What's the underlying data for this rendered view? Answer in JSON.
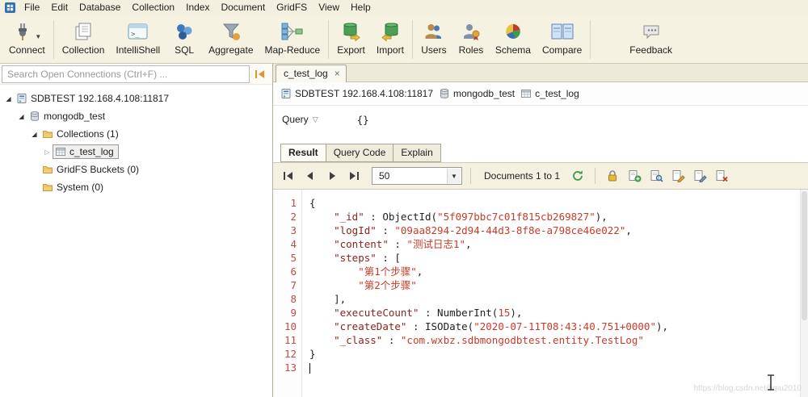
{
  "window": {
    "menu_items": [
      "File",
      "Edit",
      "Database",
      "Collection",
      "Index",
      "Document",
      "GridFS",
      "View",
      "Help"
    ]
  },
  "toolbar": {
    "buttons": [
      {
        "label": "Connect",
        "icon": "connect-icon",
        "dropdown": true,
        "group_end": true
      },
      {
        "label": "Collection",
        "icon": "collection-icon"
      },
      {
        "label": "IntelliShell",
        "icon": "intellishell-icon"
      },
      {
        "label": "SQL",
        "icon": "sql-icon"
      },
      {
        "label": "Aggregate",
        "icon": "aggregate-icon"
      },
      {
        "label": "Map-Reduce",
        "icon": "map-reduce-icon",
        "group_end": true
      },
      {
        "label": "Export",
        "icon": "export-icon"
      },
      {
        "label": "Import",
        "icon": "import-icon",
        "group_end": true
      },
      {
        "label": "Users",
        "icon": "users-icon"
      },
      {
        "label": "Roles",
        "icon": "roles-icon"
      },
      {
        "label": "Schema",
        "icon": "schema-icon"
      },
      {
        "label": "Compare",
        "icon": "compare-icon",
        "group_end": true
      },
      {
        "label": "Feedback",
        "icon": "feedback-icon",
        "far": true
      }
    ]
  },
  "sidebar": {
    "search_placeholder": "Search Open Connections (Ctrl+F) ...",
    "tree": [
      {
        "label": "SDBTEST 192.168.4.108:11817",
        "level": 0,
        "icon": "server-icon",
        "expander": "expanded"
      },
      {
        "label": "mongodb_test",
        "level": 1,
        "icon": "database-icon",
        "expander": "expanded"
      },
      {
        "label": "Collections (1)",
        "level": 2,
        "icon": "folder-icon",
        "expander": "expanded"
      },
      {
        "label": "c_test_log",
        "level": 3,
        "icon": "collection-small-icon",
        "expander": "collapsed",
        "selected": true
      },
      {
        "label": "GridFS Buckets (0)",
        "level": 2,
        "icon": "folder-icon",
        "expander": "none"
      },
      {
        "label": "System (0)",
        "level": 2,
        "icon": "folder-icon",
        "expander": "none"
      }
    ]
  },
  "tabs": [
    {
      "label": "c_test_log",
      "active": true,
      "closable": true
    }
  ],
  "breadcrumb": [
    {
      "label": "SDBTEST 192.168.4.108:11817",
      "icon": "server-icon"
    },
    {
      "label": "mongodb_test",
      "icon": "database-icon"
    },
    {
      "label": "c_test_log",
      "icon": "collection-small-icon"
    }
  ],
  "query_bar": {
    "label": "Query",
    "value": "{}"
  },
  "result_tabs": [
    {
      "label": "Result",
      "active": true
    },
    {
      "label": "Query Code",
      "active": false
    },
    {
      "label": "Explain",
      "active": false
    }
  ],
  "results_toolbar": {
    "page_size": "50",
    "documents_label": "Documents 1 to 1"
  },
  "icon_names": {
    "nav": [
      "first-page-icon",
      "previous-page-icon",
      "next-page-icon",
      "last-page-icon"
    ],
    "refresh": "refresh-icon",
    "lock": "lock-icon",
    "document_actions": [
      "add-document-icon",
      "view-document-icon",
      "edit-document-icon",
      "edit-json-icon",
      "delete-document-icon"
    ],
    "collapse_panel": "collapse-panel-icon",
    "close": "close-icon"
  },
  "editor": {
    "lines": [
      {
        "n": "1",
        "tokens": [
          {
            "t": "{",
            "c": "pl"
          }
        ]
      },
      {
        "n": "2",
        "tokens": [
          {
            "t": "    ",
            "c": "pl"
          },
          {
            "t": "\"_id\"",
            "c": "k"
          },
          {
            "t": " : ",
            "c": "pl"
          },
          {
            "t": "ObjectId(",
            "c": "f"
          },
          {
            "t": "\"5f097bbc7c01f815cb269827\"",
            "c": "s"
          },
          {
            "t": "),",
            "c": "f"
          }
        ]
      },
      {
        "n": "3",
        "tokens": [
          {
            "t": "    ",
            "c": "pl"
          },
          {
            "t": "\"logId\"",
            "c": "k"
          },
          {
            "t": " : ",
            "c": "pl"
          },
          {
            "t": "\"09aa8294-2d94-44d3-8f8e-a798ce46e022\"",
            "c": "s"
          },
          {
            "t": ",",
            "c": "pl"
          }
        ]
      },
      {
        "n": "4",
        "tokens": [
          {
            "t": "    ",
            "c": "pl"
          },
          {
            "t": "\"content\"",
            "c": "k"
          },
          {
            "t": " : ",
            "c": "pl"
          },
          {
            "t": "\"测试日志1\"",
            "c": "s"
          },
          {
            "t": ",",
            "c": "pl"
          }
        ]
      },
      {
        "n": "5",
        "tokens": [
          {
            "t": "    ",
            "c": "pl"
          },
          {
            "t": "\"steps\"",
            "c": "k"
          },
          {
            "t": " : ",
            "c": "pl"
          },
          {
            "t": "[",
            "c": "pl"
          }
        ]
      },
      {
        "n": "6",
        "tokens": [
          {
            "t": "        ",
            "c": "pl"
          },
          {
            "t": "\"第1个步骤\"",
            "c": "s"
          },
          {
            "t": ",",
            "c": "pl"
          }
        ]
      },
      {
        "n": "7",
        "tokens": [
          {
            "t": "        ",
            "c": "pl"
          },
          {
            "t": "\"第2个步骤\"",
            "c": "s"
          }
        ]
      },
      {
        "n": "8",
        "tokens": [
          {
            "t": "    ",
            "c": "pl"
          },
          {
            "t": "],",
            "c": "pl"
          }
        ]
      },
      {
        "n": "9",
        "tokens": [
          {
            "t": "    ",
            "c": "pl"
          },
          {
            "t": "\"executeCount\"",
            "c": "k"
          },
          {
            "t": " : ",
            "c": "pl"
          },
          {
            "t": "NumberInt(",
            "c": "f"
          },
          {
            "t": "15",
            "c": "n"
          },
          {
            "t": "),",
            "c": "f"
          }
        ]
      },
      {
        "n": "10",
        "tokens": [
          {
            "t": "    ",
            "c": "pl"
          },
          {
            "t": "\"createDate\"",
            "c": "k"
          },
          {
            "t": " : ",
            "c": "pl"
          },
          {
            "t": "ISODate(",
            "c": "f"
          },
          {
            "t": "\"2020-07-11T08:43:40.751+0000\"",
            "c": "s"
          },
          {
            "t": "),",
            "c": "f"
          }
        ]
      },
      {
        "n": "11",
        "tokens": [
          {
            "t": "    ",
            "c": "pl"
          },
          {
            "t": "\"_class\"",
            "c": "k"
          },
          {
            "t": " : ",
            "c": "pl"
          },
          {
            "t": "\"com.wxbz.sdbmongodbtest.entity.TestLog\"",
            "c": "s"
          }
        ]
      },
      {
        "n": "12",
        "tokens": [
          {
            "t": "}",
            "c": "pl"
          }
        ]
      },
      {
        "n": "13",
        "tokens": [],
        "cursor": true
      }
    ]
  },
  "watermark": "https://blog.csdn.net/hqiu2010",
  "colors": {
    "chrome_cream": "#f5f1e1",
    "tab_strip": "#edead9",
    "key_color": "#8a241c",
    "string_color": "#cc3a28",
    "line_number_color": "#c24a44",
    "refresh_green": "#3f9b45",
    "lock_orange": "#e8b83a"
  }
}
